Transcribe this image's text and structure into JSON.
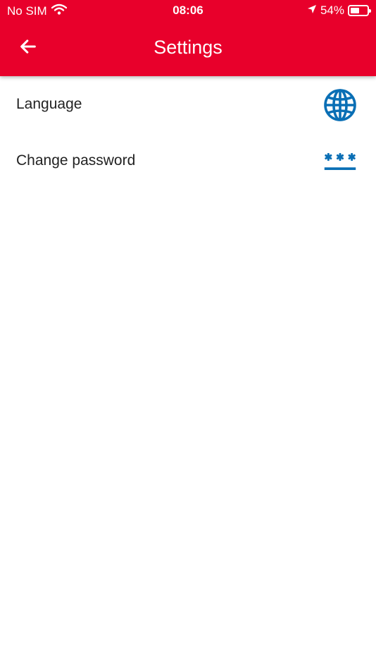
{
  "status_bar": {
    "carrier": "No SIM",
    "time": "08:06",
    "battery_percent": "54%",
    "battery_level": 0.54,
    "icons": [
      "wifi-icon",
      "location-arrow-icon",
      "battery-icon"
    ]
  },
  "toolbar": {
    "title": "Settings",
    "back_icon": "arrow-left-icon"
  },
  "settings": {
    "items": [
      {
        "label": "Language",
        "icon": "globe-icon"
      },
      {
        "label": "Change password",
        "icon": "password-icon"
      }
    ]
  },
  "colors": {
    "header": "#e8002b",
    "icon_accent": "#0a6fb5",
    "text": "#222222"
  }
}
